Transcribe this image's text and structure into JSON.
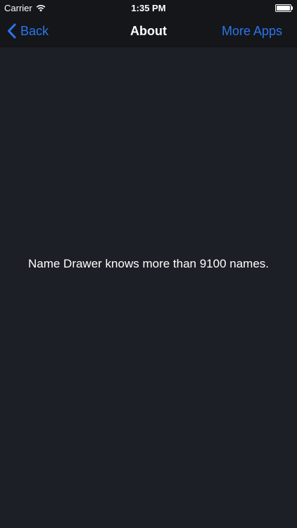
{
  "status_bar": {
    "carrier": "Carrier",
    "time": "1:35 PM",
    "battery_level": 1.0
  },
  "nav_bar": {
    "back_label": "Back",
    "title": "About",
    "right_label": "More Apps"
  },
  "content": {
    "message": "Name Drawer knows more than 9100 names."
  },
  "colors": {
    "background": "#1d1f26",
    "bar_background": "#151619",
    "accent": "#2a75ee",
    "text": "#ffffff"
  }
}
